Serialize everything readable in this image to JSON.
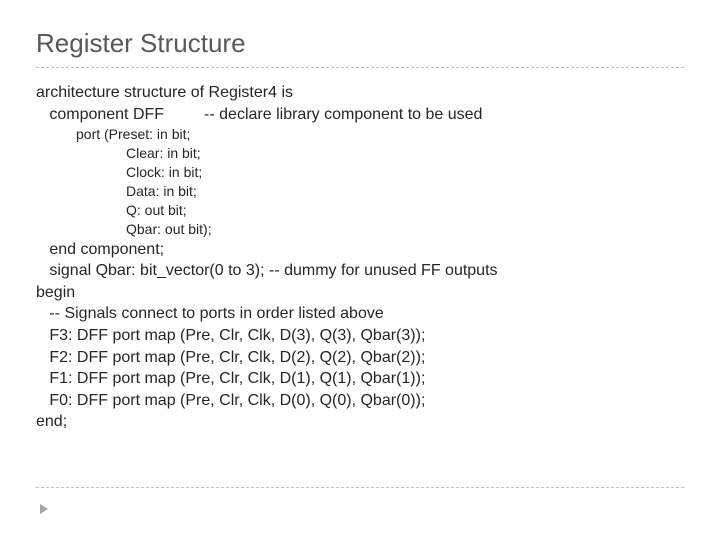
{
  "title": "Register Structure",
  "code": {
    "l1": "architecture structure of Register4 is",
    "l2": "   component DFF         -- declare library component to be used",
    "p1": "port (Preset: in bit;",
    "p2": "Clear: in bit;",
    "p3": "Clock: in bit;",
    "p4": "Data: in bit;",
    "p5": "Q: out bit;",
    "p6": "Qbar: out bit);",
    "l3": "   end component;",
    "l4": "   signal Qbar: bit_vector(0 to 3); -- dummy for unused FF outputs",
    "l5": "begin",
    "l6": "   -- Signals connect to ports in order listed above",
    "l7": "   F3: DFF port map (Pre, Clr, Clk, D(3), Q(3), Qbar(3));",
    "l8": "   F2: DFF port map (Pre, Clr, Clk, D(2), Q(2), Qbar(2));",
    "l9": "   F1: DFF port map (Pre, Clr, Clk, D(1), Q(1), Qbar(1));",
    "l10": "   F0: DFF port map (Pre, Clr, Clk, D(0), Q(0), Qbar(0));",
    "l11": "end;"
  }
}
